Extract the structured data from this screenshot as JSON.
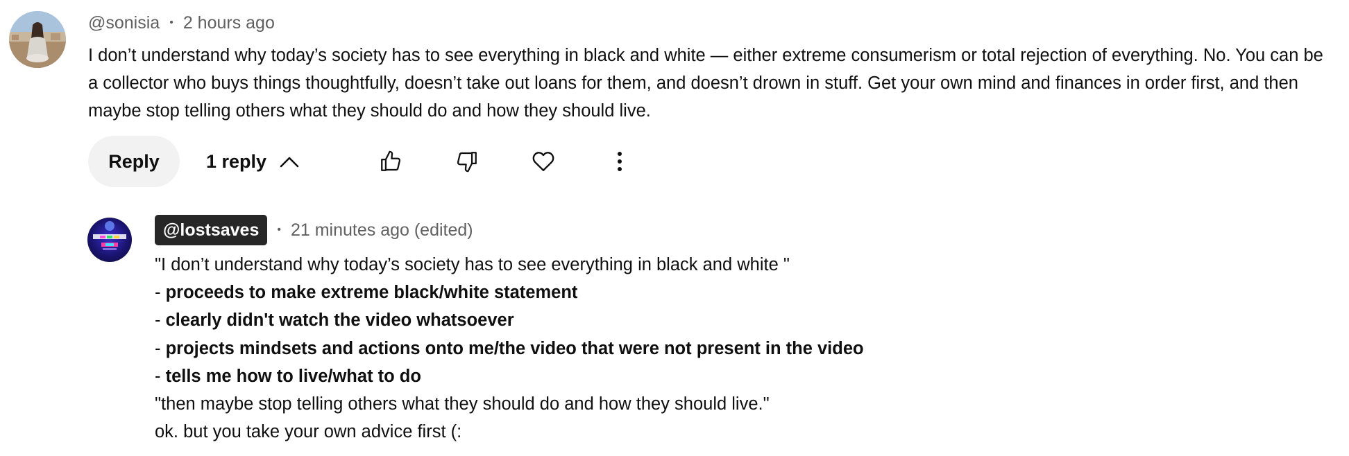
{
  "comment": {
    "handle": "@sonisia",
    "time": "2 hours ago",
    "text": "I don’t understand why today’s society has to see everything in black and white — either extreme consumerism or total rejection of everything. No. You can be a collector who buys things thoughtfully, doesn’t take out loans for them, and doesn’t drown in stuff. Get your own mind and finances in order first, and then maybe stop telling others what they should do and how they should live.",
    "actions": {
      "reply_label": "Reply",
      "replies_label": "1 reply",
      "icons": [
        "thumbs-up-icon",
        "thumbs-down-icon",
        "heart-icon",
        "more-vert-icon",
        "chevron-up-icon"
      ]
    }
  },
  "reply": {
    "handle": "@lostsaves",
    "time": "21 minutes ago (edited)",
    "lines": [
      {
        "prefix": "\"I don’t understand why today’s society has to see everything in black and white \"",
        "bold": ""
      },
      {
        "prefix": "- ",
        "bold": "proceeds to make extreme black/white statement"
      },
      {
        "prefix": "- ",
        "bold": "clearly didn't watch the video whatsoever"
      },
      {
        "prefix": "- ",
        "bold": "projects mindsets and actions onto me/the video that were not present in the video"
      },
      {
        "prefix": "- ",
        "bold": "tells me how to live/what to do"
      },
      {
        "prefix": "\"then maybe stop telling others what they should do and how they should live.\"",
        "bold": ""
      },
      {
        "prefix": "ok. but you take your own advice first (:",
        "bold": ""
      }
    ]
  },
  "colors": {
    "secondary_text": "#606060",
    "primary_text": "#0f0f0f",
    "reply_button_bg": "#f2f2f2",
    "handle_chip_bg": "#272727"
  }
}
